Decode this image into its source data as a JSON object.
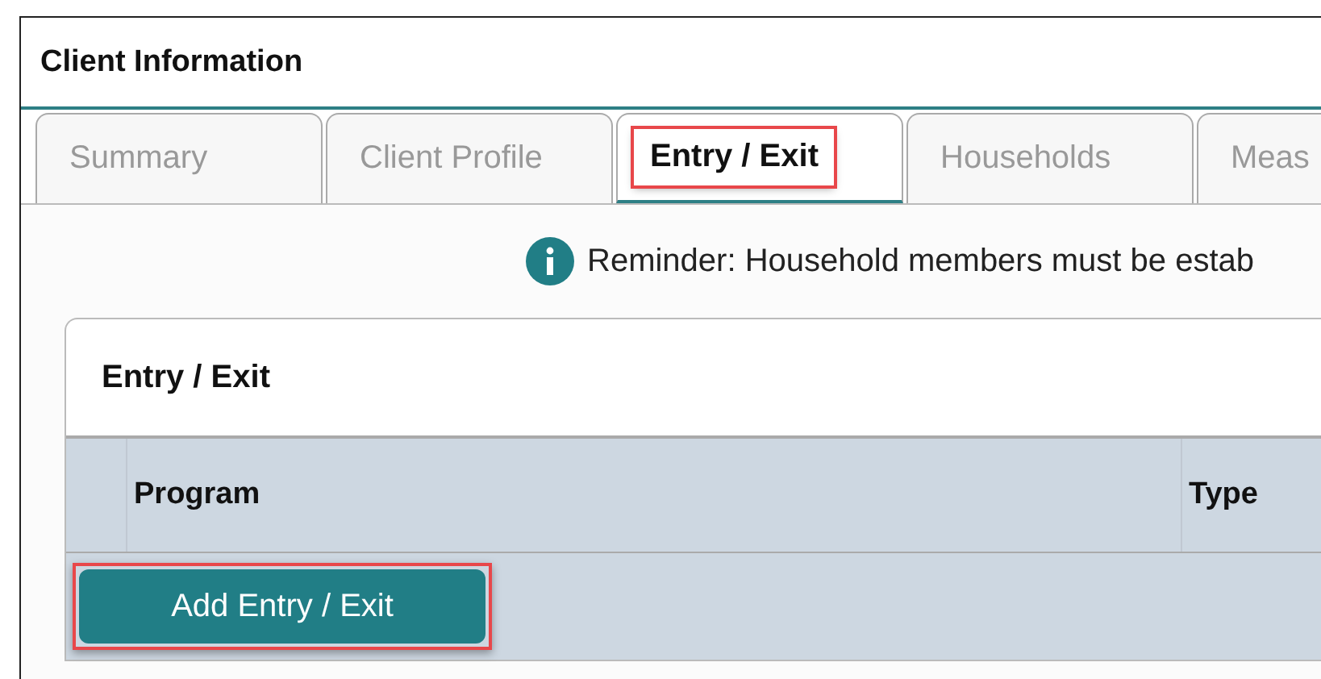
{
  "panel": {
    "title": "Client Information"
  },
  "tabs": [
    {
      "label": "Summary",
      "selected": false,
      "highlighted": false
    },
    {
      "label": "Client Profile",
      "selected": false,
      "highlighted": false
    },
    {
      "label": "Entry / Exit",
      "selected": true,
      "highlighted": true
    },
    {
      "label": "Households",
      "selected": false,
      "highlighted": false
    },
    {
      "label": "Meas",
      "selected": false,
      "highlighted": false
    }
  ],
  "reminder": "Reminder: Household members must be estab",
  "card": {
    "title": "Entry / Exit",
    "columns": [
      "Program",
      "Type"
    ],
    "add_button": {
      "label": "Add Entry / Exit",
      "highlighted": true
    }
  }
}
